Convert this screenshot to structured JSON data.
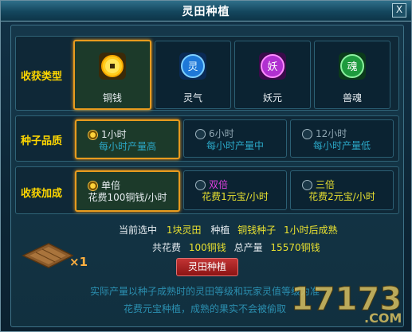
{
  "window": {
    "title": "灵田种植",
    "close_label": "X"
  },
  "harvest_type": {
    "label": "收获类型",
    "options": [
      {
        "name": "铜钱",
        "icon": "copper-coin-icon",
        "selected": true,
        "glyph": ""
      },
      {
        "name": "灵气",
        "icon": "spirit-qi-icon",
        "selected": false,
        "glyph": "灵"
      },
      {
        "name": "妖元",
        "icon": "demon-essence-icon",
        "selected": false,
        "glyph": "妖"
      },
      {
        "name": "兽魂",
        "icon": "beast-soul-icon",
        "selected": false,
        "glyph": "魂"
      }
    ]
  },
  "seed_quality": {
    "label": "种子品质",
    "options": [
      {
        "title": "1小时",
        "desc": "每小时产量高",
        "selected": true
      },
      {
        "title": "6小时",
        "desc": "每小时产量中",
        "selected": false
      },
      {
        "title": "12小时",
        "desc": "每小时产量低",
        "selected": false
      }
    ]
  },
  "harvest_bonus": {
    "label": "收获加成",
    "options": [
      {
        "title": "单倍",
        "desc": "花费100铜钱/小时",
        "selected": true
      },
      {
        "title": "双倍",
        "desc": "花费1元宝/小时",
        "selected": false
      },
      {
        "title": "三倍",
        "desc": "花费2元宝/小时",
        "selected": false
      }
    ]
  },
  "summary": {
    "line1": {
      "a": "当前选中",
      "b": "1块灵田",
      "c": "种植",
      "d": "铜钱种子",
      "e": "1小时后成熟"
    },
    "line2": {
      "a": "共花费",
      "b": "100铜钱",
      "c": "总产量",
      "d": "15570铜钱"
    },
    "field_count": "×1"
  },
  "plant_button": "灵田种植",
  "notes": {
    "line1": "实际产量以种子成熟时的灵田等级和玩家灵值等级为准",
    "line2": "花费元宝种植，成熟的果实不会被偷取"
  },
  "watermark": {
    "main": "17173",
    "sub": ".COM"
  },
  "colors": {
    "gold": "#ffd700",
    "cyan": "#2ba8c8",
    "magenta": "#e040e0",
    "yellow_green": "#e8e030",
    "selected_border": "#e89b1e",
    "button_red": "#b42424"
  }
}
